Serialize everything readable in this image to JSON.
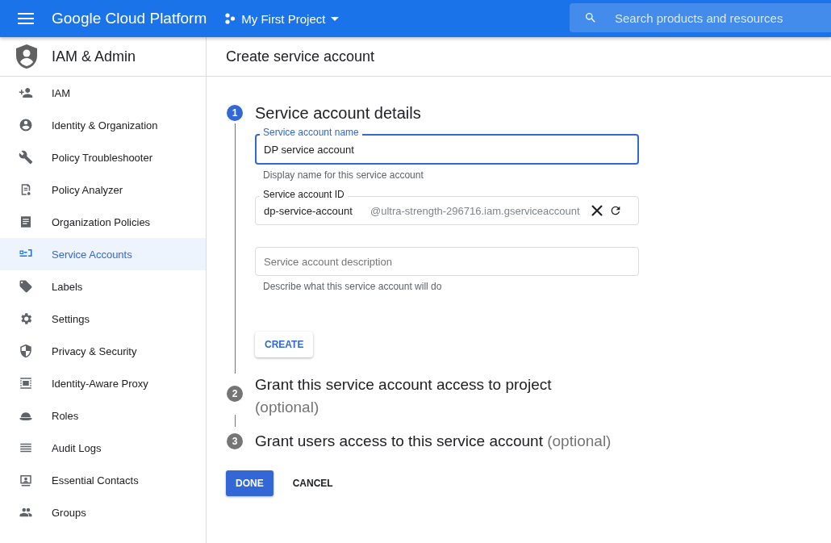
{
  "topbar": {
    "brand": "Google Cloud Platform",
    "project": "My First Project",
    "search": {
      "placeholder": "Search products and resources"
    }
  },
  "sidebar": {
    "title": "IAM & Admin",
    "items": [
      {
        "label": "IAM",
        "selected": false
      },
      {
        "label": "Identity & Organization",
        "selected": false
      },
      {
        "label": "Policy Troubleshooter",
        "selected": false
      },
      {
        "label": "Policy Analyzer",
        "selected": false
      },
      {
        "label": "Organization Policies",
        "selected": false
      },
      {
        "label": "Service Accounts",
        "selected": true
      },
      {
        "label": "Labels",
        "selected": false
      },
      {
        "label": "Settings",
        "selected": false
      },
      {
        "label": "Privacy & Security",
        "selected": false
      },
      {
        "label": "Identity-Aware Proxy",
        "selected": false
      },
      {
        "label": "Roles",
        "selected": false
      },
      {
        "label": "Audit Logs",
        "selected": false
      },
      {
        "label": "Essential Contacts",
        "selected": false
      },
      {
        "label": "Groups",
        "selected": false
      }
    ]
  },
  "page": {
    "title": "Create service account",
    "steps": [
      {
        "number": "1",
        "title": "Service account details",
        "selected": true
      },
      {
        "number": "2",
        "title": "Grant this service account access to project",
        "optional": "(optional)",
        "selected": false
      },
      {
        "number": "3",
        "title": "Grant users access to this service account",
        "optional": "(optional)",
        "selected": false
      }
    ],
    "form": {
      "name": {
        "label": "Service account name",
        "value": "DP service account",
        "hint": "Display name for this service account"
      },
      "id": {
        "label": "Service account ID",
        "value": "dp-service-account",
        "suffix": "@ultra-strength-296716.iam.gserviceaccount"
      },
      "description": {
        "placeholder": "Service account description",
        "hint": "Describe what this service account will do"
      },
      "create_button": "CREATE"
    },
    "buttons": {
      "done": "DONE",
      "cancel": "CANCEL"
    }
  }
}
